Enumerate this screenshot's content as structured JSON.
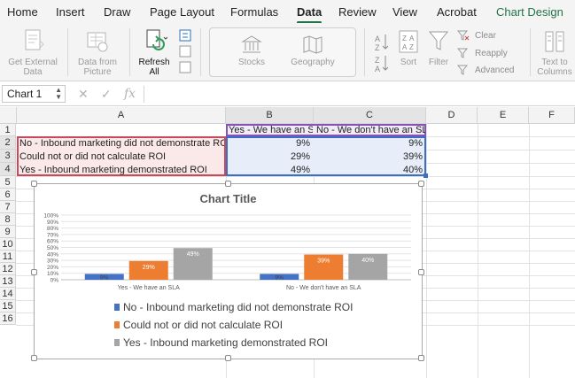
{
  "ribbon_tabs": [
    {
      "label": "Home"
    },
    {
      "label": "Insert"
    },
    {
      "label": "Draw"
    },
    {
      "label": "Page Layout"
    },
    {
      "label": "Formulas"
    },
    {
      "label": "Data"
    },
    {
      "label": "Review"
    },
    {
      "label": "View"
    },
    {
      "label": "Acrobat"
    },
    {
      "label": "Chart Design"
    }
  ],
  "active_tab": "Data",
  "ribbon": {
    "get_external_data": "Get External Data",
    "data_from_picture": "Data from Picture",
    "refresh_all": "Refresh All",
    "stocks": "Stocks",
    "geography": "Geography",
    "sort": "Sort",
    "filter": "Filter",
    "clear": "Clear",
    "reapply": "Reapply",
    "advanced": "Advanced",
    "text_to_columns": "Text to Columns"
  },
  "formula_bar": {
    "name_box": "Chart 1",
    "cancel_icon": "✕",
    "enter_icon": "✓",
    "fx": "fx",
    "formula": ""
  },
  "grid": {
    "columns": [
      "A",
      "B",
      "C",
      "D",
      "E",
      "F"
    ],
    "rows": [
      "1",
      "2",
      "3",
      "4",
      "5",
      "6",
      "7",
      "8",
      "9",
      "10",
      "11",
      "12",
      "13",
      "14",
      "15",
      "16"
    ],
    "cells": {
      "B1": "Yes - We have an SLA",
      "C1": "No - We don't have an SLA",
      "A2": "No - Inbound marketing did not demonstrate ROI",
      "B2": "9%",
      "C2": "9%",
      "A3": "Could not or did not calculate ROI",
      "B3": "29%",
      "C3": "39%",
      "A4": "Yes - Inbound marketing demonstrated ROI",
      "B4": "49%",
      "C4": "40%"
    }
  },
  "chart_data": {
    "type": "bar",
    "title": "Chart Title",
    "categories": [
      "Yes - We have an SLA",
      "No - We don't have an SLA"
    ],
    "series": [
      {
        "name": "No - Inbound marketing did not demonstrate ROI",
        "values": [
          9,
          9
        ],
        "color": "#4472C4"
      },
      {
        "name": "Could not or did not calculate ROI",
        "values": [
          29,
          39
        ],
        "color": "#ED7D31"
      },
      {
        "name": "Yes - Inbound marketing demonstrated ROI",
        "values": [
          49,
          40
        ],
        "color": "#A5A5A5"
      }
    ],
    "data_labels": [
      [
        "9%",
        "9%"
      ],
      [
        "29%",
        "39%"
      ],
      [
        "49%",
        "40%"
      ]
    ],
    "y_ticks": [
      "0%",
      "10%",
      "20%",
      "30%",
      "40%",
      "50%",
      "60%",
      "70%",
      "80%",
      "90%",
      "100%"
    ],
    "ylim": [
      0,
      100
    ],
    "grid": true,
    "legend_position": "bottom",
    "xlabel": "",
    "ylabel": ""
  }
}
